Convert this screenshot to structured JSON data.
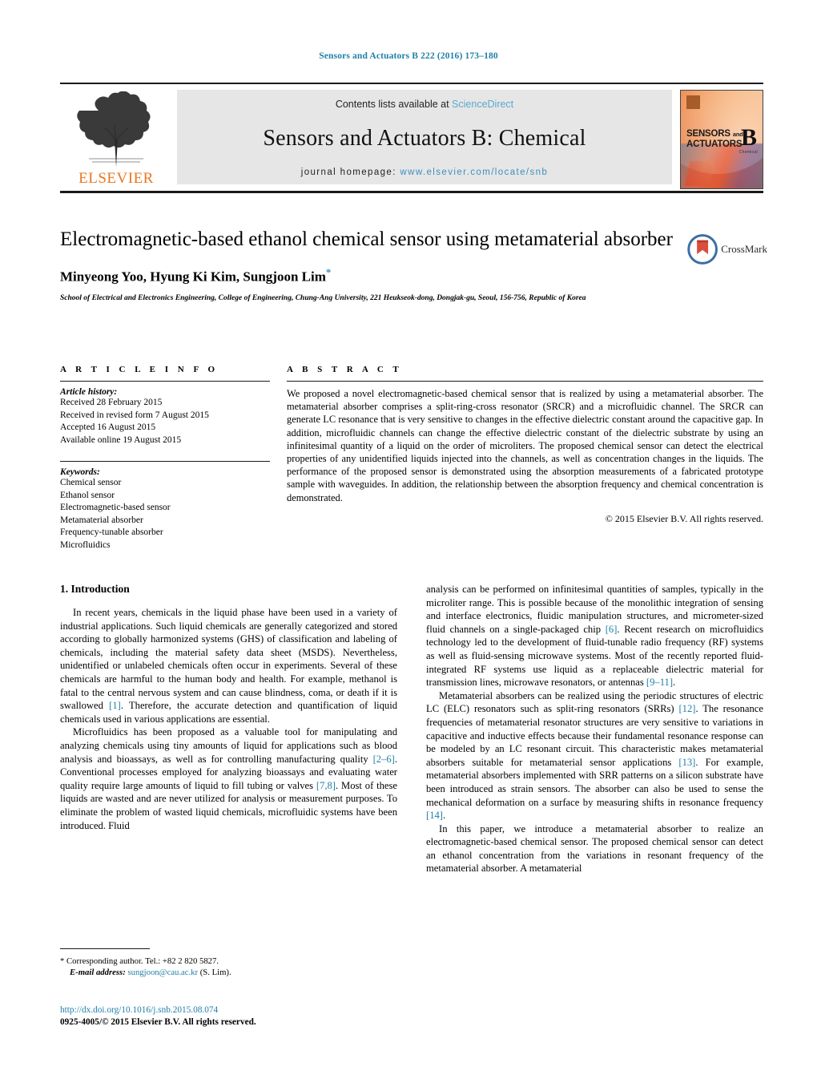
{
  "running_head": "Sensors and Actuators B 222 (2016) 173–180",
  "masthead": {
    "publisher_logo_text": "ELSEVIER",
    "contents_prefix": "Contents lists available at ",
    "contents_link": "ScienceDirect",
    "journal_title": "Sensors and Actuators B: Chemical",
    "homepage_prefix": "journal homepage: ",
    "homepage_url": "www.elsevier.com/locate/snb",
    "cover": {
      "line1": "SENSORS",
      "line1_small": "and",
      "line2": "ACTUATORS",
      "letter": "B",
      "letter_sub": "Chemical"
    }
  },
  "article": {
    "title": "Electromagnetic-based ethanol chemical sensor using metamaterial absorber",
    "authors": "Minyeong Yoo, Hyung Ki Kim, Sungjoon Lim",
    "corresponding_marker": "*",
    "affiliation": "School of Electrical and Electronics Engineering, College of Engineering, Chung-Ang University, 221 Heukseok-dong, Dongjak-gu, Seoul, 156-756, Republic of Korea",
    "crossmark_label": "CrossMark"
  },
  "article_info": {
    "heading": "A R T I C L E   I N F O",
    "history_title": "Article history:",
    "history": [
      "Received 28 February 2015",
      "Received in revised form 7 August 2015",
      "Accepted 16 August 2015",
      "Available online 19 August 2015"
    ],
    "keywords_title": "Keywords:",
    "keywords": [
      "Chemical sensor",
      "Ethanol sensor",
      "Electromagnetic-based sensor",
      "Metamaterial absorber",
      "Frequency-tunable absorber",
      "Microfluidics"
    ]
  },
  "abstract": {
    "heading": "A B S T R A C T",
    "text": "We proposed a novel electromagnetic-based chemical sensor that is realized by using a metamaterial absorber. The metamaterial absorber comprises a split-ring-cross resonator (SRCR) and a microfluidic channel. The SRCR can generate LC resonance that is very sensitive to changes in the effective dielectric constant around the capacitive gap. In addition, microfluidic channels can change the effective dielectric constant of the dielectric substrate by using an infinitesimal quantity of a liquid on the order of microliters. The proposed chemical sensor can detect the electrical properties of any unidentified liquids injected into the channels, as well as concentration changes in the liquids. The performance of the proposed sensor is demonstrated using the absorption measurements of a fabricated prototype sample with waveguides. In addition, the relationship between the absorption frequency and chemical concentration is demonstrated.",
    "copyright": "© 2015 Elsevier B.V. All rights reserved."
  },
  "introduction": {
    "heading": "1.  Introduction",
    "left_p1": "In recent years, chemicals in the liquid phase have been used in a variety of industrial applications. Such liquid chemicals are generally categorized and stored according to globally harmonized systems (GHS) of classification and labeling of chemicals, including the material safety data sheet (MSDS). Nevertheless, unidentified or unlabeled chemicals often occur in experiments. Several of these chemicals are harmful to the human body and health. For example, methanol is fatal to the central nervous system and can cause blindness, coma, or death if it is swallowed [1]. Therefore, the accurate detection and quantification of liquid chemicals used in various applications are essential.",
    "left_p2": "Microfluidics has been proposed as a valuable tool for manipulating and analyzing chemicals using tiny amounts of liquid for applications such as blood analysis and bioassays, as well as for controlling manufacturing quality [2–6]. Conventional processes employed for analyzing bioassays and evaluating water quality require large amounts of liquid to fill tubing or valves [7,8]. Most of these liquids are wasted and are never utilized for analysis or measurement purposes. To eliminate the problem of wasted liquid chemicals, microfluidic systems have been introduced. Fluid",
    "right_p1": "analysis can be performed on infinitesimal quantities of samples, typically in the microliter range. This is possible because of the monolithic integration of sensing and interface electronics, fluidic manipulation structures, and micrometer-sized fluid channels on a single-packaged chip [6]. Recent research on microfluidics technology led to the development of fluid-tunable radio frequency (RF) systems as well as fluid-sensing microwave systems. Most of the recently reported fluid-integrated RF systems use liquid as a replaceable dielectric material for transmission lines, microwave resonators, or antennas [9–11].",
    "right_p2": "Metamaterial absorbers can be realized using the periodic structures of electric LC (ELC) resonators such as split-ring resonators (SRRs) [12]. The resonance frequencies of metamaterial resonator structures are very sensitive to variations in capacitive and inductive effects because their fundamental resonance response can be modeled by an LC resonant circuit. This characteristic makes metamaterial absorbers suitable for metamaterial sensor applications [13]. For example, metamaterial absorbers implemented with SRR patterns on a silicon substrate have been introduced as strain sensors. The absorber can also be used to sense the mechanical deformation on a surface by measuring shifts in resonance frequency [14].",
    "right_p3": "In this paper, we introduce a metamaterial absorber to realize an electromagnetic-based chemical sensor. The proposed chemical sensor can detect an ethanol concentration from the variations in resonant frequency of the metamaterial absorber. A metamaterial"
  },
  "footer": {
    "corresponding_marker": "*",
    "corresponding_text": "Corresponding author. Tel.: +82 2 820 5827.",
    "email_label": "E-mail address:",
    "email": "sungjoon@cau.ac.kr",
    "email_owner": "(S. Lim).",
    "doi": "http://dx.doi.org/10.1016/j.snb.2015.08.074",
    "issn": "0925-4005/© 2015 Elsevier B.V. All rights reserved."
  },
  "colors": {
    "link": "#1f7fa8",
    "elsevier_orange": "#E87722",
    "masthead_bg": "#e6e6e6"
  }
}
